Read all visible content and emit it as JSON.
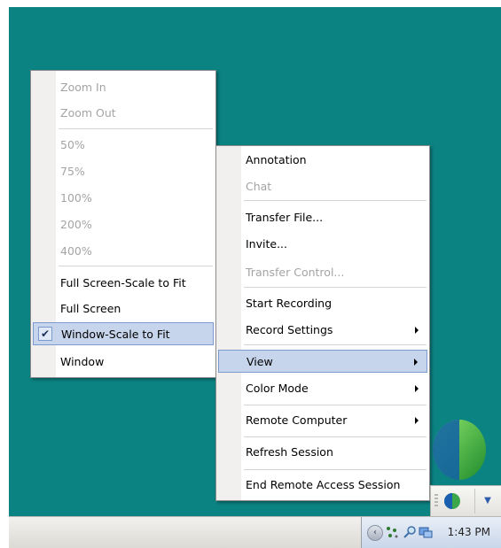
{
  "left_menu": {
    "items": [
      {
        "label": "Zoom In",
        "disabled": true
      },
      {
        "label": "Zoom Out",
        "disabled": true
      },
      {
        "label": "50%",
        "disabled": true
      },
      {
        "label": "75%",
        "disabled": true
      },
      {
        "label": "100%",
        "disabled": true
      },
      {
        "label": "200%",
        "disabled": true
      },
      {
        "label": "400%",
        "disabled": true
      },
      {
        "label": "Full Screen-Scale to Fit",
        "disabled": false
      },
      {
        "label": "Full Screen",
        "disabled": false
      },
      {
        "label": "Window-Scale to Fit",
        "disabled": false,
        "checked": true,
        "check_mark": "✔"
      },
      {
        "label": "Window",
        "disabled": false
      }
    ]
  },
  "right_menu": {
    "items": [
      {
        "label": "Annotation",
        "disabled": false
      },
      {
        "label": "Chat",
        "disabled": true
      },
      {
        "label": "Transfer File...",
        "disabled": false
      },
      {
        "label": "Invite...",
        "disabled": false
      },
      {
        "label": "Transfer Control...",
        "disabled": true
      },
      {
        "label": "Start Recording",
        "disabled": false
      },
      {
        "label": "Record Settings",
        "disabled": false,
        "submenu": true
      },
      {
        "label": "View",
        "disabled": false,
        "submenu": true,
        "highlighted": true
      },
      {
        "label": "Color Mode",
        "disabled": false,
        "submenu": true
      },
      {
        "label": "Remote Computer",
        "disabled": false,
        "submenu": true
      },
      {
        "label": "Refresh Session",
        "disabled": false
      },
      {
        "label": "End Remote Access Session",
        "disabled": false
      }
    ]
  },
  "taskbar": {
    "clock": "1:43 PM",
    "tray_icons": [
      "chevron-left-icon",
      "network-icon",
      "magnifier-icon",
      "share-icon"
    ]
  },
  "colors": {
    "desktop": "#0b8383",
    "highlight": "#c7d5ec",
    "highlight_border": "#7b9bd0"
  }
}
